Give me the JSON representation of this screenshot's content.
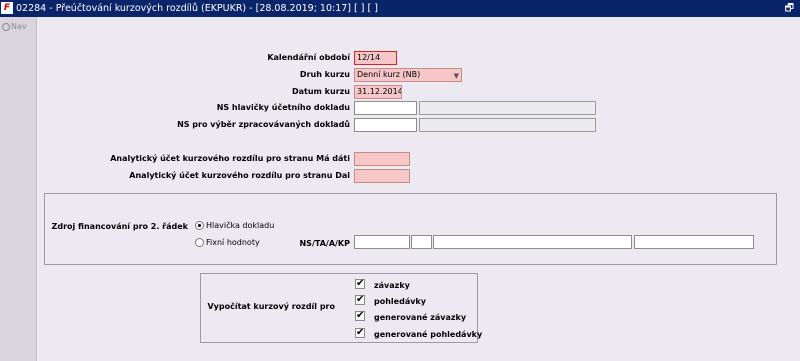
{
  "window": {
    "title": "02284 - Přeúčtování kurzových rozdílů (EKPUKR) - [28.08.2019; 10:17]  [ ]  [ ]",
    "app_icon": "app-logo-icon",
    "restore_glyph": "🗗"
  },
  "sidebar": {
    "nav_label": "Nav"
  },
  "form": {
    "kalendarni_obdobi": {
      "label": "Kalendářní období",
      "value": "12/14"
    },
    "druh_kurzu": {
      "label": "Druh kurzu",
      "value": "Denní kurz (NB)"
    },
    "datum_kurzu": {
      "label": "Datum kurzu",
      "value": "31.12.2014"
    },
    "ns_hlavicky": {
      "label": "NS hlavičky účetního dokladu",
      "value": "",
      "value2": ""
    },
    "ns_vyber": {
      "label": "NS pro výběr zpracovávaných dokladů",
      "value": "",
      "value2": ""
    },
    "ucet_ma_dati": {
      "label": "Analytický účet kurzového rozdílu pro stranu Má dáti",
      "value": ""
    },
    "ucet_dal": {
      "label": "Analytický účet kurzového rozdílu pro stranu Dal",
      "value": ""
    }
  },
  "zdroj": {
    "label": "Zdroj financování pro 2. řádek",
    "options": [
      "Hlavička dokladu",
      "Fixní hodnoty"
    ],
    "selected": "Hlavička dokladu",
    "ns_label": "NS/TA/A/KP",
    "ns_values": [
      "",
      "",
      "",
      ""
    ]
  },
  "vypocitat": {
    "label": "Vypočítat kurzový rozdíl pro",
    "items": [
      {
        "label": "závazky",
        "checked": true
      },
      {
        "label": "pohledávky",
        "checked": true
      },
      {
        "label": "generované závazky",
        "checked": true
      },
      {
        "label": "generované pohledávky",
        "checked": true
      }
    ],
    "check_glyph": "✔"
  },
  "colors": {
    "title_bar": "#0a246a",
    "required_field": "#f6c6c8",
    "background": "#ece9f0"
  }
}
